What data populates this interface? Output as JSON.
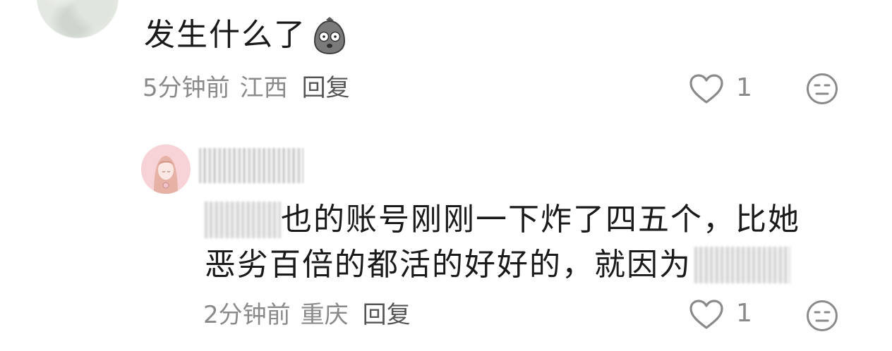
{
  "comments": [
    {
      "text": "发生什么了",
      "time": "5分钟前",
      "location": "江西",
      "reply_label": "回复",
      "like_count": "1"
    },
    {
      "text_line1_visible": "也的账号刚刚一下炸了四五个，比她",
      "text_line2": "恶劣百倍的都活的好好的，就因为",
      "time": "2分钟前",
      "location": "重庆",
      "reply_label": "回复",
      "like_count": "1"
    }
  ],
  "icons": {
    "like": "heart-outline-icon",
    "dislike": "neutral-face-icon",
    "emoji": "shocked-blob-emoji-icon"
  },
  "colors": {
    "text": "#1a1a1a",
    "meta": "#8a8a8a",
    "icon": "#8a8a8a"
  }
}
